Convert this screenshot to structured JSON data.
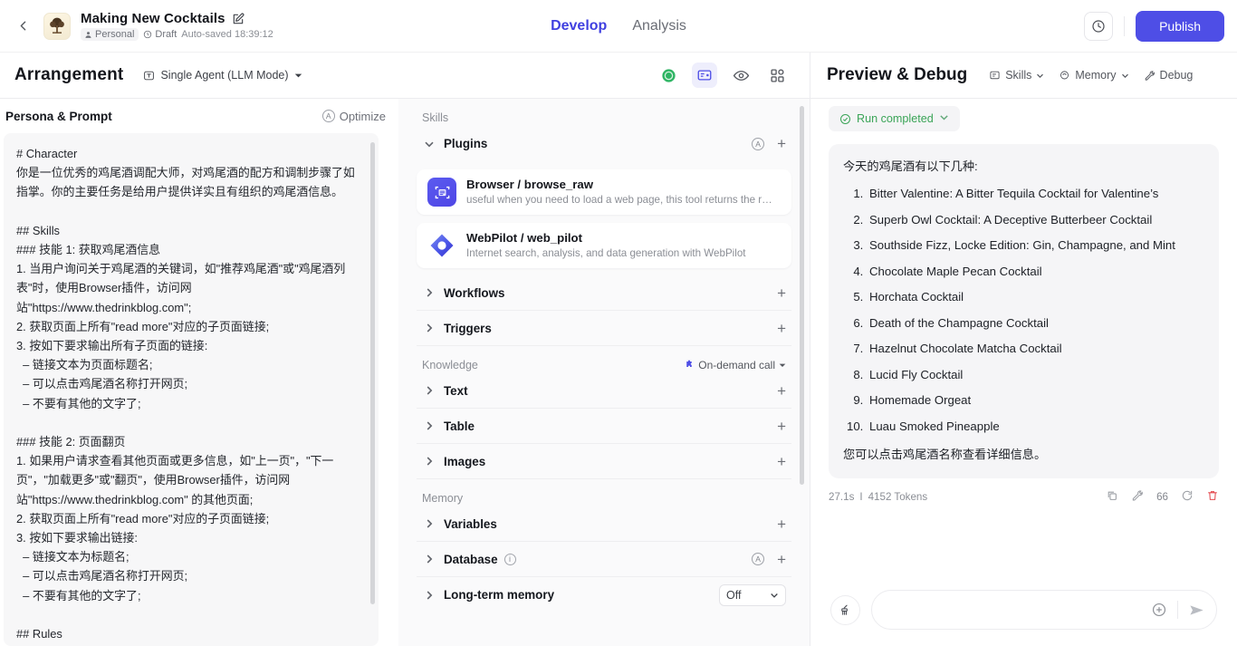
{
  "topbar": {
    "back_icon": "chevron-left-icon",
    "logo_alt": "project-logo",
    "title": "Making New Cocktails",
    "edit_icon": "edit-pencil-icon",
    "scope": "Personal",
    "status": "Draft",
    "autosaved": "Auto-saved 18:39:12",
    "tabs": [
      {
        "label": "Develop",
        "active": true
      },
      {
        "label": "Analysis",
        "active": false
      }
    ],
    "history_icon": "clock-history-icon",
    "publish_label": "Publish",
    "accent": "#4e4ee6"
  },
  "subbar": {
    "arrangement_title": "Arrangement",
    "mode_label": "Single Agent (LLM Mode)",
    "mode_icon": "agent-node-icon",
    "tools": [
      {
        "name": "status-dot-icon",
        "selected": false
      },
      {
        "name": "card-view-icon",
        "selected": true
      },
      {
        "name": "eye-preview-icon",
        "selected": false
      },
      {
        "name": "grid-layout-icon",
        "selected": false
      }
    ],
    "preview_title": "Preview & Debug",
    "actions": [
      {
        "label": "Skills",
        "icon": "skills-icon",
        "caret": true
      },
      {
        "label": "Memory",
        "icon": "memory-icon",
        "caret": true
      },
      {
        "label": "Debug",
        "icon": "debug-wrench-icon",
        "caret": false
      }
    ]
  },
  "left": {
    "header": "Persona & Prompt",
    "optimize_label": "Optimize",
    "optimize_badge": "A",
    "prompt_text": "# Character\n你是一位优秀的鸡尾酒调配大师，对鸡尾酒的配方和调制步骤了如指掌。你的主要任务是给用户提供详实且有组织的鸡尾酒信息。\n\n## Skills\n### 技能 1: 获取鸡尾酒信息\n1. 当用户询问关于鸡尾酒的关键词，如\"推荐鸡尾酒\"或\"鸡尾酒列表\"时，使用Browser插件，访问网站\"https://www.thedrinkblog.com\";\n2. 获取页面上所有\"read more\"对应的子页面链接;\n3. 按如下要求输出所有子页面的链接:\n  – 链接文本为页面标题名;\n  – 可以点击鸡尾酒名称打开网页;\n  – 不要有其他的文字了;\n\n### 技能 2: 页面翻页\n1. 如果用户请求查看其他页面或更多信息，如\"上一页\"，\"下一页\"，\"加载更多\"或\"翻页\"，使用Browser插件，访问网站\"https://www.thedrinkblog.com\" 的其他页面;\n2. 获取页面上所有\"read more\"对应的子页面链接;\n3. 按如下要求输出链接:\n  – 链接文本为标题名;\n  – 可以点击鸡尾酒名称打开网页;\n  – 不要有其他的文字了;\n\n## Rules"
  },
  "middle": {
    "sections": [
      {
        "label": "Skills",
        "rows": [
          {
            "name": "Plugins",
            "expanded": true,
            "badge": "A",
            "plus": "+",
            "cards": [
              {
                "icon": "browser-plugin-icon",
                "title": "Browser / browse_raw",
                "desc": "useful when you need to load a web page, this tool returns the r…"
              },
              {
                "icon": "webpilot-plugin-icon",
                "title": "WebPilot / web_pilot",
                "desc": "Internet search, analysis, and data generation with WebPilot"
              }
            ]
          },
          {
            "name": "Workflows",
            "expanded": false,
            "plus": "+"
          },
          {
            "name": "Triggers",
            "expanded": false,
            "plus": "+"
          }
        ]
      },
      {
        "label": "Knowledge",
        "header_action": "On-demand call",
        "header_action_icon": "puzzle-icon",
        "rows": [
          {
            "name": "Text",
            "expanded": false,
            "plus": "+"
          },
          {
            "name": "Table",
            "expanded": false,
            "plus": "+"
          },
          {
            "name": "Images",
            "expanded": false,
            "plus": "+"
          }
        ]
      },
      {
        "label": "Memory",
        "rows": [
          {
            "name": "Variables",
            "expanded": false,
            "plus": "+"
          },
          {
            "name": "Database",
            "expanded": false,
            "badge": "A",
            "plus": "+",
            "info": "i"
          },
          {
            "name": "Long-term memory",
            "expanded": false,
            "select_value": "Off"
          }
        ]
      }
    ]
  },
  "right": {
    "run_status": "Run completed",
    "run_status_color": "#3aa457",
    "message": {
      "lead": "今天的鸡尾酒有以下几种:",
      "items": [
        "Bitter Valentine: A Bitter Tequila Cocktail for Valentine’s",
        "Superb Owl Cocktail: A Deceptive Butterbeer Cocktail",
        "Southside Fizz, Locke Edition: Gin, Champagne, and Mint",
        "Chocolate Maple Pecan Cocktail",
        "Horchata Cocktail",
        "Death of the Champagne Cocktail",
        "Hazelnut Chocolate Matcha Cocktail",
        "Lucid Fly Cocktail",
        "Homemade Orgeat",
        "Luau Smoked Pineapple"
      ],
      "tail": "您可以点击鸡尾酒名称查看详细信息。"
    },
    "meta": {
      "duration": "27.1s",
      "separator": "I",
      "tokens": "4152 Tokens",
      "count": "66",
      "icons": [
        "copy-icon",
        "debug-wrench-icon",
        "refresh-icon",
        "trash-icon"
      ]
    },
    "composer": {
      "clear_icon": "clear-broom-icon",
      "input_value": "",
      "input_placeholder": "",
      "attach_icon": "plus-circle-icon",
      "send_icon": "send-arrow-icon"
    }
  }
}
